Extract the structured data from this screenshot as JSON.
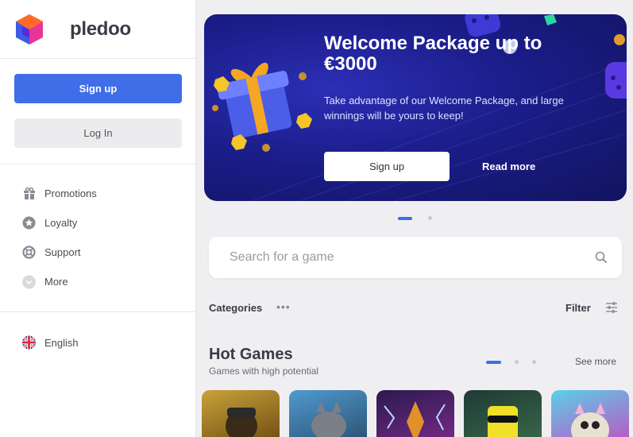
{
  "brand": {
    "name": "pledoo"
  },
  "auth": {
    "signup_label": "Sign up",
    "login_label": "Log In"
  },
  "nav": {
    "items": [
      {
        "label": "Promotions",
        "icon": "gift-icon"
      },
      {
        "label": "Loyalty",
        "icon": "star-icon"
      },
      {
        "label": "Support",
        "icon": "lifebuoy-icon"
      },
      {
        "label": "More",
        "icon": "chevron-down-icon"
      }
    ],
    "language": {
      "label": "English",
      "icon": "uk-flag-icon"
    }
  },
  "banner": {
    "title": "Welcome Package up to €3000",
    "text": "Take advantage of our Welcome Package, and large winnings will be yours to keep!",
    "signup_label": "Sign up",
    "readmore_label": "Read more",
    "active_slide": 1,
    "slide_count": 2
  },
  "search": {
    "placeholder": "Search for a game",
    "value": ""
  },
  "categories": {
    "label": "Categories",
    "more_label": "•••",
    "filter_label": "Filter"
  },
  "hot_games": {
    "title": "Hot Games",
    "subtitle": "Games with high potential",
    "see_more_label": "See more",
    "active_page": 1,
    "page_count": 3,
    "games": [
      {
        "name": "game-1",
        "color": "#a8822a"
      },
      {
        "name": "game-2",
        "color": "#3e6f93"
      },
      {
        "name": "game-3",
        "color": "#5a2a7a"
      },
      {
        "name": "game-4",
        "color": "#2a4f46"
      },
      {
        "name": "game-5",
        "color": "#b94fb2"
      }
    ]
  },
  "colors": {
    "accent": "#3f6ee8",
    "banner_bg": "#1b1d8a"
  }
}
